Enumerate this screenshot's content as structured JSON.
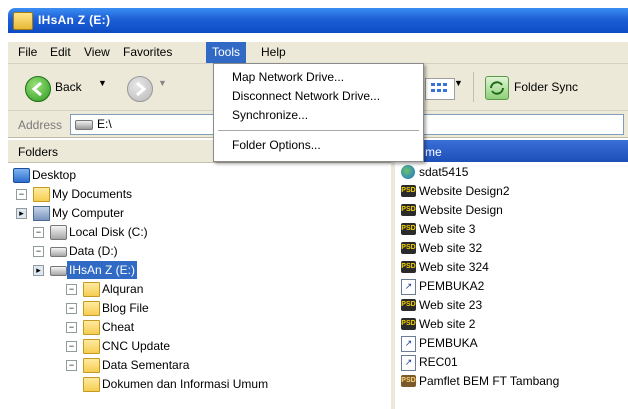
{
  "window": {
    "title": "IHsAn Z (E:)"
  },
  "menubar": {
    "items": [
      "File",
      "Edit",
      "View",
      "Favorites",
      "Tools",
      "Help"
    ],
    "open_item": "Tools"
  },
  "toolbar": {
    "back_label": "Back",
    "folder_sync_label": "Folder Sync"
  },
  "address": {
    "label": "Address",
    "value": "E:\\"
  },
  "folders_pane": {
    "title": "Folders",
    "tree": [
      {
        "label": "Desktop",
        "level": 0,
        "expander": "",
        "icon": "desktop-icon"
      },
      {
        "label": "My Documents",
        "level": 1,
        "expander": "minus",
        "icon": "folder-icon"
      },
      {
        "label": "My Computer",
        "level": 1,
        "expander": "plus",
        "icon": "computer-icon"
      },
      {
        "label": "Local Disk (C:)",
        "level": 2,
        "expander": "minus",
        "icon": "disk-icon"
      },
      {
        "label": "Data (D:)",
        "level": 2,
        "expander": "minus",
        "icon": "disk-icon"
      },
      {
        "label": "IHsAn Z (E:)",
        "level": 2,
        "expander": "plus",
        "icon": "disk-icon",
        "selected": true
      },
      {
        "label": "Alquran",
        "level": 3,
        "expander": "minus",
        "icon": "folder-icon"
      },
      {
        "label": "Blog File",
        "level": 3,
        "expander": "minus",
        "icon": "folder-icon"
      },
      {
        "label": "Cheat",
        "level": 3,
        "expander": "minus",
        "icon": "folder-icon"
      },
      {
        "label": "CNC Update",
        "level": 3,
        "expander": "minus",
        "icon": "folder-icon"
      },
      {
        "label": "Data Sementara",
        "level": 3,
        "expander": "minus",
        "icon": "folder-icon"
      },
      {
        "label": "Dokumen dan Informasi Umum",
        "level": 3,
        "expander": "",
        "icon": "folder-icon"
      }
    ]
  },
  "files_pane": {
    "column_header": "me",
    "files": [
      {
        "name": "sdat5415",
        "icon": "globe"
      },
      {
        "name": "Website Design2",
        "icon": "psd"
      },
      {
        "name": "Website Design",
        "icon": "psd"
      },
      {
        "name": "Web site 3",
        "icon": "psd"
      },
      {
        "name": "Web site 32",
        "icon": "psd"
      },
      {
        "name": "Web site 324",
        "icon": "psd"
      },
      {
        "name": "PEMBUKA2",
        "icon": "lnk"
      },
      {
        "name": "Web site 23",
        "icon": "psd"
      },
      {
        "name": "Web site 2",
        "icon": "psd"
      },
      {
        "name": "PEMBUKA",
        "icon": "lnk"
      },
      {
        "name": "REC01",
        "icon": "lnk"
      },
      {
        "name": "Pamflet BEM FT Tambang",
        "icon": "psd"
      }
    ]
  },
  "tools_menu": {
    "items": [
      "Map Network Drive...",
      "Disconnect Network Drive...",
      "Synchronize...",
      "Folder Options..."
    ]
  },
  "colors": {
    "titlebar": "#1d5fd6",
    "menu_highlight": "#316ac5",
    "chrome": "#ece9d8"
  }
}
